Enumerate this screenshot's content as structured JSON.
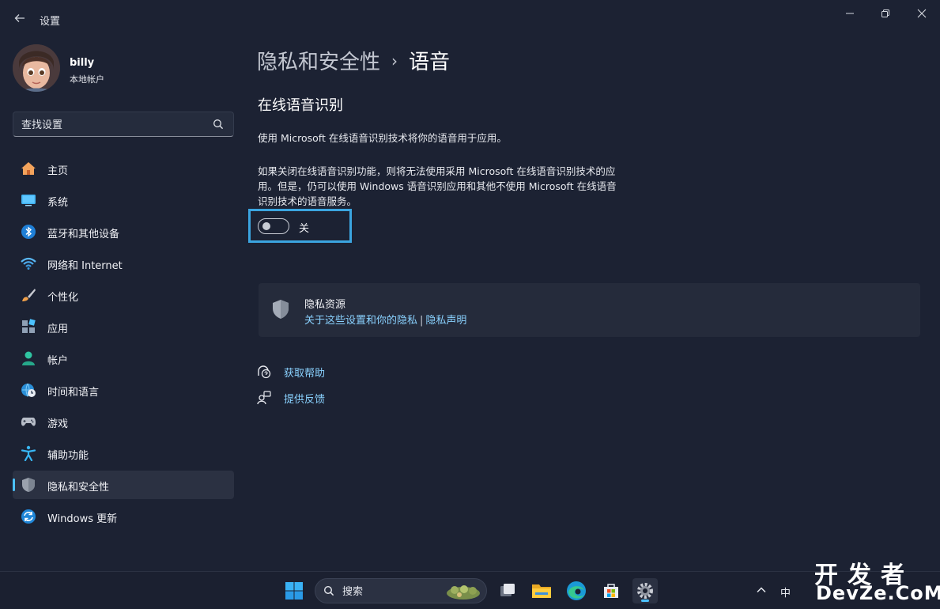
{
  "window": {
    "title": "设置"
  },
  "profile": {
    "name": "billy",
    "account_type": "本地帐户"
  },
  "search": {
    "placeholder": "查找设置"
  },
  "sidebar": {
    "items": [
      {
        "label": "主页",
        "icon": "home-icon"
      },
      {
        "label": "系统",
        "icon": "system-icon"
      },
      {
        "label": "蓝牙和其他设备",
        "icon": "bluetooth-icon"
      },
      {
        "label": "网络和 Internet",
        "icon": "wifi-icon"
      },
      {
        "label": "个性化",
        "icon": "brush-icon"
      },
      {
        "label": "应用",
        "icon": "apps-icon"
      },
      {
        "label": "帐户",
        "icon": "account-icon"
      },
      {
        "label": "时间和语言",
        "icon": "time-language-icon"
      },
      {
        "label": "游戏",
        "icon": "gamepad-icon"
      },
      {
        "label": "辅助功能",
        "icon": "accessibility-icon"
      },
      {
        "label": "隐私和安全性",
        "icon": "shield-icon",
        "active": true
      },
      {
        "label": "Windows 更新",
        "icon": "update-icon"
      }
    ]
  },
  "breadcrumb": {
    "parent": "隐私和安全性",
    "separator": "›",
    "current": "语音"
  },
  "section": {
    "title": "在线语音识别",
    "description": "使用 Microsoft 在线语音识别技术将你的语音用于应用。",
    "details": "如果关闭在线语音识别功能，则将无法使用采用 Microsoft 在线语音识别技术的应用。但是，仍可以使用 Windows 语音识别应用和其他不使用 Microsoft 在线语音识别技术的语音服务。",
    "toggle_state": "关"
  },
  "privacy_resources": {
    "title": "隐私资源",
    "link1": "关于这些设置和你的隐私",
    "separator": "|",
    "link2": "隐私声明"
  },
  "help": {
    "get_help": "获取帮助",
    "feedback": "提供反馈"
  },
  "taskbar": {
    "search_placeholder": "搜索",
    "tray_chevron": "^",
    "ime": "中"
  },
  "watermark": {
    "top": "开发者",
    "bottom": "DevZe.CoM"
  },
  "colors": {
    "background": "#1c2233",
    "accent": "#4cc2ff",
    "link": "#8ad2ff",
    "highlight_border": "#3ba5e0"
  }
}
